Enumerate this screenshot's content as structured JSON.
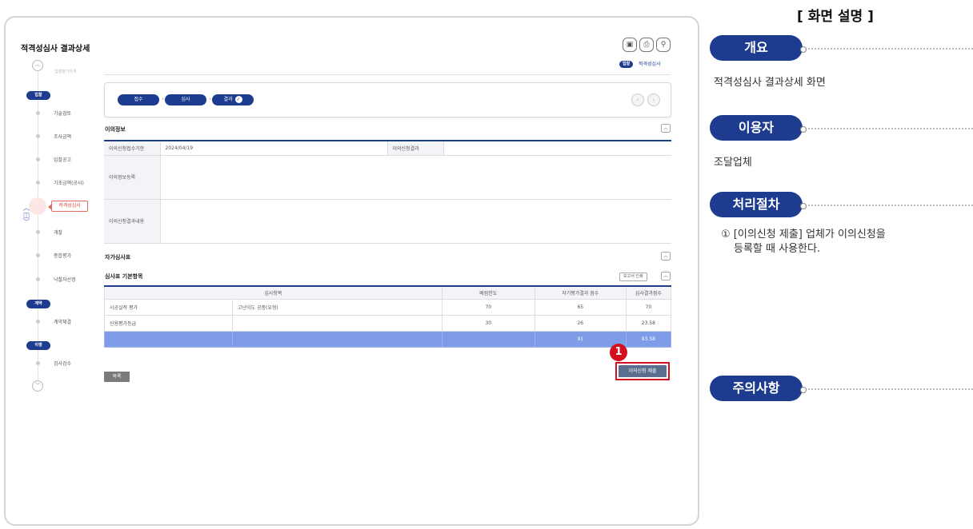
{
  "screen": {
    "title": "적격성심사 결과상세",
    "ghost_step": "입찰참가자격",
    "sidebar": {
      "group_bid": "입찰",
      "group_contract": "계약",
      "group_perform": "이행",
      "items_bid": [
        "기술검토",
        "조사금액",
        "입찰공고",
        "기초금액(공사)",
        "적격성심사",
        "개찰",
        "종합평가",
        "낙찰자선정"
      ],
      "items_contract": [
        "계약체결"
      ],
      "items_perform": [
        "검사검수"
      ],
      "active_index": 4
    },
    "top_icons": [
      "doc-icon",
      "print-icon",
      "zoom-icon"
    ],
    "biz_badge": "입찰",
    "biz_name": "적격성심사",
    "progress": {
      "steps": [
        "접수",
        "심사",
        "결과"
      ],
      "current": "결과"
    },
    "objection": {
      "section_title": "이의정보",
      "rows": [
        {
          "label": "이의신청접수기한",
          "value": "2024/04/19",
          "label2": "이의신청결과",
          "value2": ""
        },
        {
          "label": "이의정보등록",
          "value": ""
        },
        {
          "label": "이의신청결과내용",
          "value": ""
        }
      ]
    },
    "self_review": {
      "section_title": "자가심사표",
      "sub_title": "심사표 기본항목",
      "print_button": "보고서 인쇄",
      "headers": [
        "심사항목",
        "배점한도",
        "자기평가결과 점수",
        "심사결과점수"
      ],
      "rows": [
        {
          "item": "시공실적 평가",
          "sub": "고난이도 공종(유형)",
          "limit": "70",
          "self": "65",
          "result": "70"
        },
        {
          "item": "신용평가등급",
          "sub": "",
          "limit": "30",
          "self": "26",
          "result": "23.58"
        }
      ],
      "total": {
        "self": "91",
        "result": "93.58"
      }
    },
    "callout_number": "1",
    "submit_button": "이의신청 제출",
    "list_button": "목록"
  },
  "panel": {
    "title": "[ 화면 설명 ]",
    "overview_label": "개요",
    "overview_text": "적격성심사 결과상세 화면",
    "user_label": "이용자",
    "user_text": "조달업체",
    "process_label": "처리절차",
    "process_text": "① [이의신청 제출] 업체가 이의신청을",
    "process_text2": "등록할 때 사용한다.",
    "caution_label": "주의사항"
  },
  "colors": {
    "primary": "#1d3b8f",
    "accent": "#d40f1f",
    "summary_row": "#7f9ce8"
  }
}
